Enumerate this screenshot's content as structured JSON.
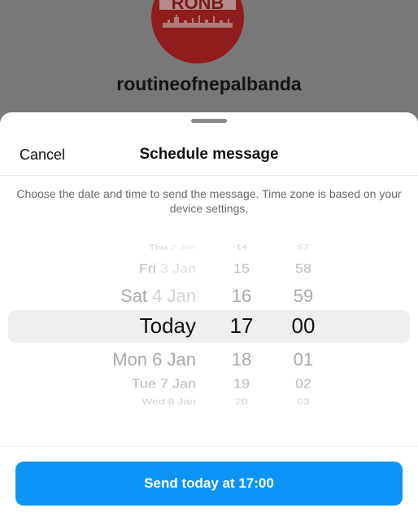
{
  "profile": {
    "logo_text": "RONB",
    "username": "routineofnepalbanda"
  },
  "sheet": {
    "cancel_label": "Cancel",
    "title": "Schedule message",
    "description": "Choose the date and time to send the message. Time zone is based on your device settings."
  },
  "picker": {
    "dates": [
      {
        "day": "Thu",
        "date": "2 Jan"
      },
      {
        "day": "Fri",
        "date": "3 Jan"
      },
      {
        "day": "Sat",
        "date": "4 Jan"
      },
      {
        "day": "Today",
        "date": ""
      },
      {
        "day": "Mon",
        "date": "6 Jan"
      },
      {
        "day": "Tue",
        "date": "7 Jan"
      },
      {
        "day": "Wed",
        "date": "8 Jan"
      }
    ],
    "hours": [
      "14",
      "15",
      "16",
      "17",
      "18",
      "19",
      "20"
    ],
    "minutes": [
      "57",
      "58",
      "59",
      "00",
      "01",
      "02",
      "03"
    ],
    "selected_index": 3
  },
  "send_button_label": "Send today at 17:00",
  "colors": {
    "accent": "#0a95f6",
    "logo_red": "#8f1d1d"
  }
}
